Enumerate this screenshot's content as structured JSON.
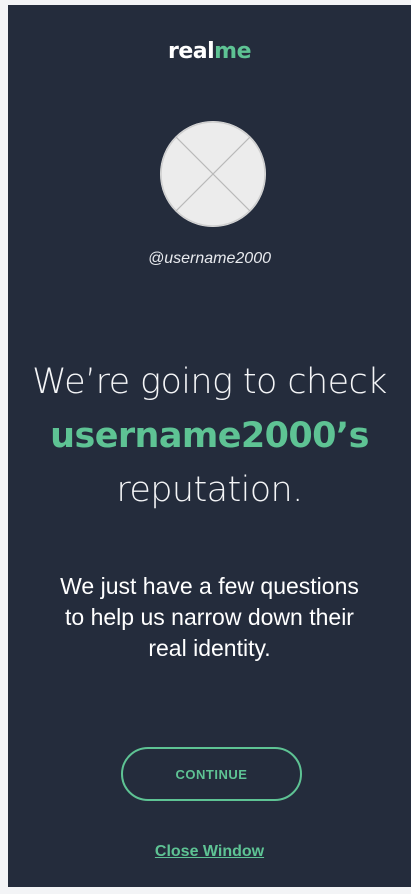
{
  "brand": {
    "part1": "real",
    "part2": "me"
  },
  "profile": {
    "handle": "@username2000"
  },
  "headline": {
    "line1": "We’re going to check",
    "name": "username2000’s",
    "line3": "reputation."
  },
  "subtext": "We just have a few questions to help us narrow down their real identity.",
  "actions": {
    "continue_label": "CONTINUE",
    "close_label": "Close Window"
  },
  "colors": {
    "background": "#242c3c",
    "accent": "#5ec394",
    "page": "#f3f4f6"
  },
  "icons": {
    "avatar": "image-placeholder-icon"
  }
}
